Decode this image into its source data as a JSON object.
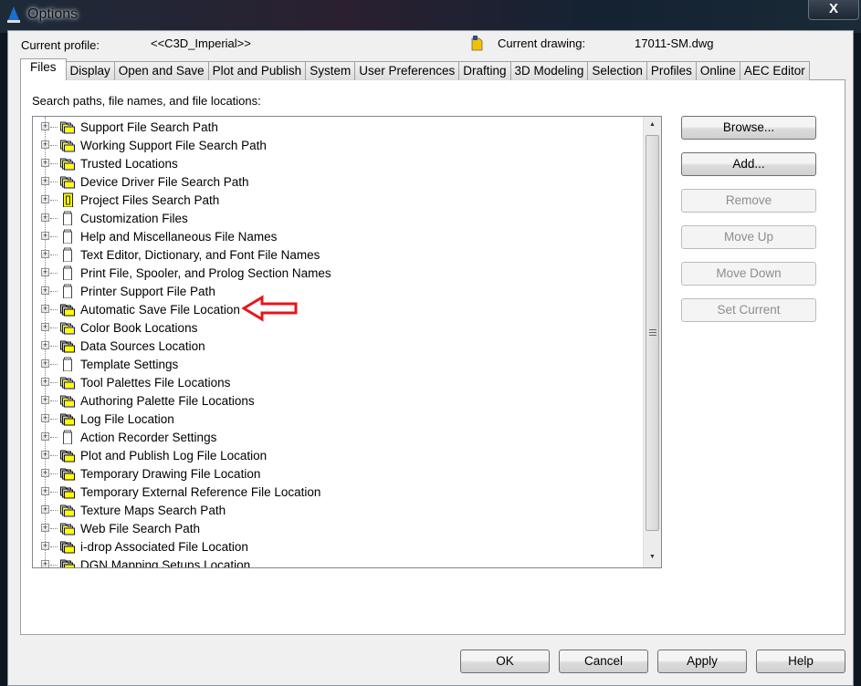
{
  "window": {
    "title": "Options",
    "close_label": "X"
  },
  "header": {
    "profile_label": "Current profile:",
    "profile_value": "<<C3D_Imperial>>",
    "drawing_label": "Current drawing:",
    "drawing_value": "17011-SM.dwg"
  },
  "tabs": [
    "Files",
    "Display",
    "Open and Save",
    "Plot and Publish",
    "System",
    "User Preferences",
    "Drafting",
    "3D Modeling",
    "Selection",
    "Profiles",
    "Online",
    "AEC Editor"
  ],
  "active_tab": "Files",
  "files": {
    "section_label": "Search paths, file names, and file locations:",
    "items": [
      {
        "label": "Support File Search Path",
        "icon": "folders-blue"
      },
      {
        "label": "Working Support File Search Path",
        "icon": "folders-blue"
      },
      {
        "label": "Trusted Locations",
        "icon": "folders-blue"
      },
      {
        "label": "Device Driver File Search Path",
        "icon": "folders-blue"
      },
      {
        "label": "Project Files Search Path",
        "icon": "project"
      },
      {
        "label": "Customization Files",
        "icon": "file"
      },
      {
        "label": "Help and Miscellaneous File Names",
        "icon": "file"
      },
      {
        "label": "Text Editor, Dictionary, and Font File Names",
        "icon": "file"
      },
      {
        "label": "Print File, Spooler, and Prolog Section Names",
        "icon": "file"
      },
      {
        "label": "Printer Support File Path",
        "icon": "file"
      },
      {
        "label": "Automatic Save File Location",
        "icon": "folders-dark",
        "highlighted_by_arrow": true
      },
      {
        "label": "Color Book Locations",
        "icon": "folders-blue"
      },
      {
        "label": "Data Sources Location",
        "icon": "folders-dark"
      },
      {
        "label": "Template Settings",
        "icon": "file"
      },
      {
        "label": "Tool Palettes File Locations",
        "icon": "folders-blue"
      },
      {
        "label": "Authoring Palette File Locations",
        "icon": "folders-blue"
      },
      {
        "label": "Log File Location",
        "icon": "folders-dark"
      },
      {
        "label": "Action Recorder Settings",
        "icon": "file"
      },
      {
        "label": "Plot and Publish Log File Location",
        "icon": "folders-dark"
      },
      {
        "label": "Temporary Drawing File Location",
        "icon": "folders-dark"
      },
      {
        "label": "Temporary External Reference File Location",
        "icon": "folders-dark"
      },
      {
        "label": "Texture Maps Search Path",
        "icon": "folders-blue"
      },
      {
        "label": "Web File Search Path",
        "icon": "folders-blue"
      },
      {
        "label": "i-drop Associated File Location",
        "icon": "folders-dark"
      },
      {
        "label": "DGN Mapping Setups Location",
        "icon": "folders-dark"
      }
    ],
    "side_buttons": [
      {
        "label": "Browse...",
        "enabled": true
      },
      {
        "label": "Add...",
        "enabled": true
      },
      {
        "label": "Remove",
        "enabled": false
      },
      {
        "label": "Move Up",
        "enabled": false
      },
      {
        "label": "Move Down",
        "enabled": false
      },
      {
        "label": "Set Current",
        "enabled": false
      }
    ]
  },
  "footer": {
    "ok": "OK",
    "cancel": "Cancel",
    "apply": "Apply",
    "help": "Help"
  },
  "colors": {
    "annotation_arrow": "#e8141c",
    "folder_yellow": "#ffff00"
  }
}
